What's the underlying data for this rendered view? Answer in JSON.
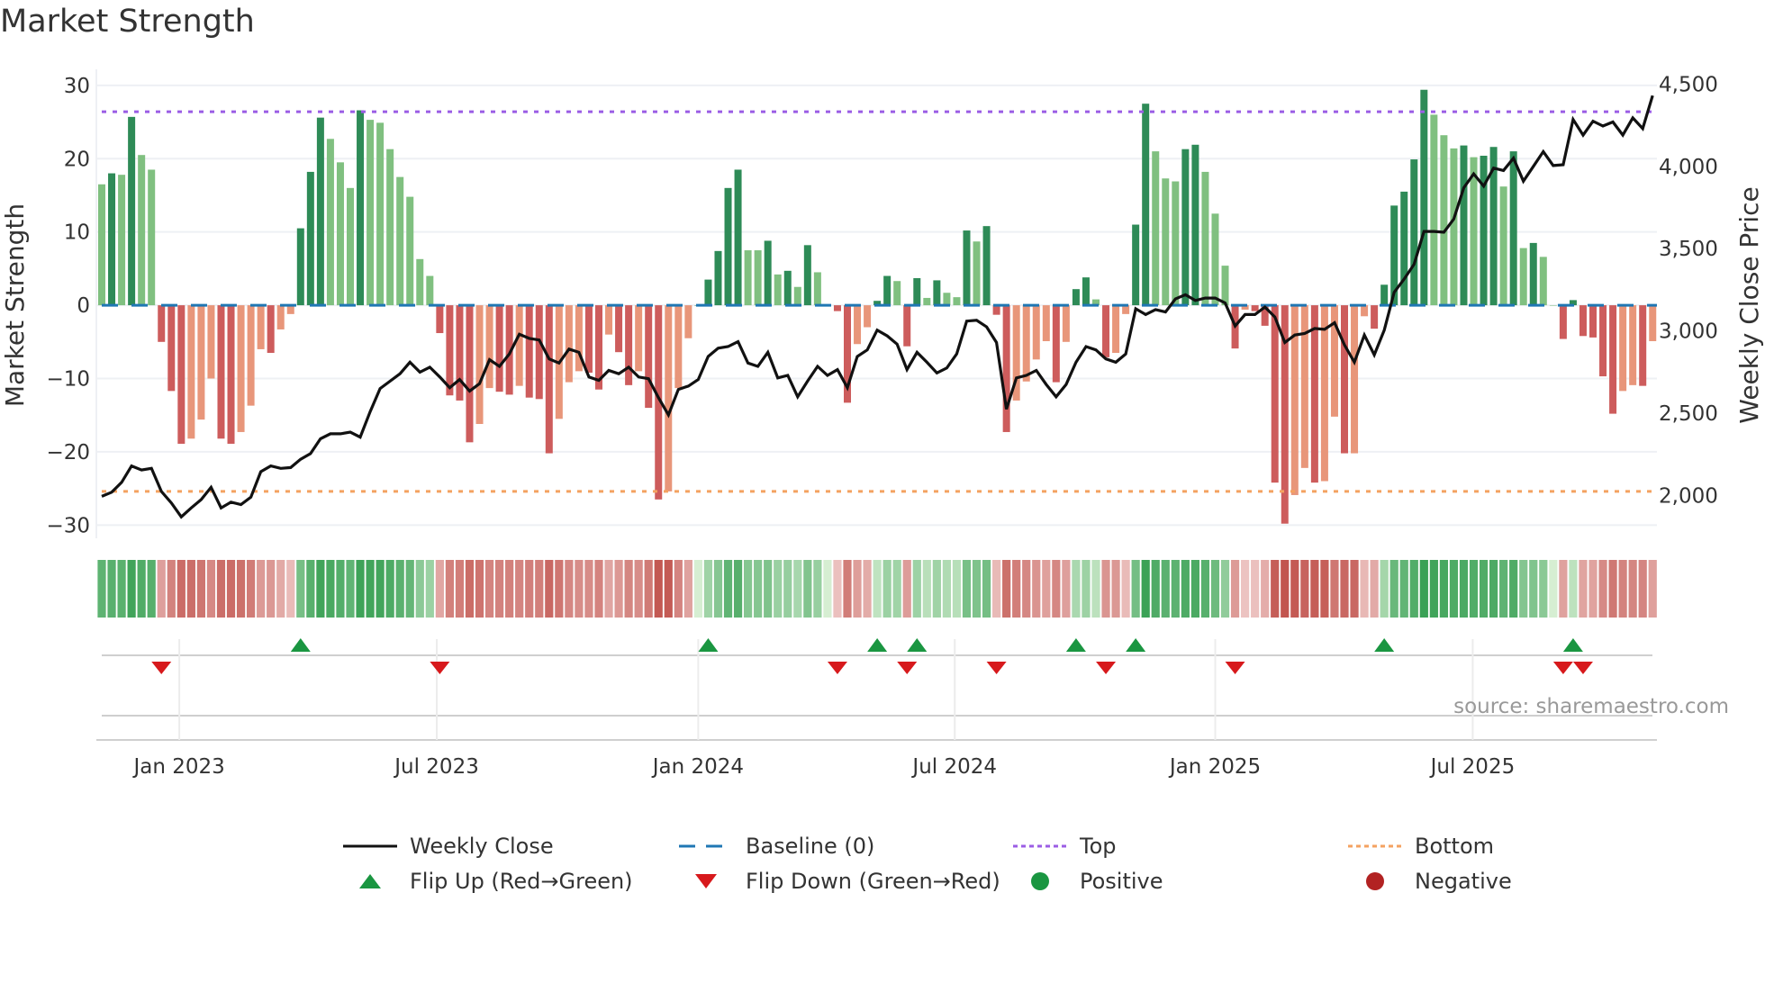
{
  "title": "Market Strength",
  "source": "source: sharemaestro.com",
  "legend": {
    "weekly_close": "Weekly Close",
    "baseline": "Baseline (0)",
    "top": "Top",
    "bottom": "Bottom",
    "flip_up": "Flip Up (Red→Green)",
    "flip_down": "Flip Down (Green→Red)",
    "positive": "Positive",
    "negative": "Negative"
  },
  "colors": {
    "pos_rising": "#2e8b57",
    "pos_falling": "#80c080",
    "neg_falling": "#cd5c5c",
    "neg_rising": "#e8967a",
    "line": "#111111",
    "baseline": "#1f77b4",
    "top": "#9b5de5",
    "bottom": "#f4a261",
    "flip_up": "#1a9641",
    "flip_down": "#d7191c",
    "positive": "#1a9641",
    "negative": "#b22222"
  },
  "chart_data": {
    "type": "bar",
    "title": "Market Strength",
    "ylabel": "Market Strength",
    "y2label": "Weekly Close Price",
    "ylim": [
      -31.8,
      31.7
    ],
    "y2lim": [
      1740,
      4568
    ],
    "yticks": [
      30,
      20,
      10,
      0,
      -10,
      -20,
      -30
    ],
    "ytick_labels": [
      "30",
      "20",
      "10",
      "0",
      "−10",
      "−20",
      "−30"
    ],
    "y2ticks": [
      4500,
      4000,
      3500,
      3000,
      2500,
      2000
    ],
    "y2tick_labels": [
      "4,500",
      "4,000",
      "3,500",
      "3,000",
      "2,500",
      "2,000"
    ],
    "xticks": [
      7.8,
      33.7,
      60,
      85.8,
      112,
      137.9
    ],
    "xtick_labels": [
      "Jan 2023",
      "Jul 2023",
      "Jan 2024",
      "Jul 2024",
      "Jan 2025",
      "Jul 2025"
    ],
    "top_level": 26.4,
    "bottom_level": -25.4,
    "baseline": 0,
    "strength": [
      16.5,
      18,
      17.8,
      25.7,
      20.5,
      18.5,
      -5,
      -11.7,
      -18.9,
      -18.2,
      -15.6,
      -10,
      -18.2,
      -18.9,
      -17.3,
      -13.7,
      -6,
      -6.5,
      -3.3,
      -1.2,
      10.5,
      18.2,
      25.6,
      22.7,
      19.5,
      16,
      26.6,
      25.3,
      24.9,
      21.3,
      17.5,
      14.8,
      6.3,
      4,
      -3.8,
      -12.3,
      -13,
      -18.7,
      -16.2,
      -11.3,
      -11.8,
      -12.2,
      -11,
      -12.6,
      -12.8,
      -20.2,
      -15.5,
      -10.5,
      -9,
      -9.2,
      -11.5,
      -4,
      -6.4,
      -10.9,
      -9,
      -14,
      -26.5,
      -25.4,
      -11.3,
      -4.5,
      0,
      3.5,
      7.4,
      16,
      18.5,
      7.5,
      7.5,
      8.8,
      4.2,
      4.7,
      2.5,
      8.2,
      4.5,
      0,
      -0.8,
      -13.3,
      -5.3,
      -3,
      0.6,
      4,
      3.3,
      -5.6,
      3.7,
      1,
      3.4,
      1.7,
      1.1,
      10.2,
      8.7,
      10.8,
      -1.3,
      -17.3,
      -13,
      -10.4,
      -7.4,
      -4.9,
      -10.5,
      -5,
      2.2,
      3.8,
      0.8,
      -7.1,
      -6.5,
      -1.2,
      11,
      27.5,
      21,
      17.3,
      16.9,
      21.3,
      21.9,
      18.2,
      12.5,
      5.4,
      -5.9,
      -0.6,
      -0.8,
      -2.8,
      -24.2,
      -29.8,
      -25.9,
      -22.2,
      -24.2,
      -24,
      -15.2,
      -20.2,
      -20.2,
      -1.5,
      -3.2,
      2.8,
      13.6,
      15.5,
      19.9,
      29.4,
      26,
      23.2,
      21.4,
      21.8,
      20.2,
      20.4,
      21.6,
      16.2,
      21,
      7.8,
      8.5,
      6.6,
      0,
      -4.6,
      0.7,
      -4.2,
      -4.4,
      -9.7,
      -14.8,
      -11.7,
      -10.9,
      -11,
      -4.9
    ],
    "weekly_close": [
      1995,
      2020,
      2080,
      2180,
      2155,
      2165,
      2025,
      1955,
      1870,
      1925,
      1975,
      2050,
      1925,
      1960,
      1945,
      1990,
      2145,
      2180,
      2165,
      2170,
      2220,
      2255,
      2345,
      2375,
      2375,
      2385,
      2355,
      2510,
      2650,
      2695,
      2740,
      2810,
      2750,
      2780,
      2720,
      2655,
      2705,
      2635,
      2680,
      2825,
      2785,
      2860,
      2980,
      2955,
      2945,
      2830,
      2805,
      2890,
      2870,
      2720,
      2700,
      2760,
      2740,
      2780,
      2720,
      2710,
      2595,
      2490,
      2645,
      2665,
      2705,
      2845,
      2895,
      2905,
      2935,
      2805,
      2785,
      2870,
      2715,
      2730,
      2600,
      2695,
      2785,
      2730,
      2765,
      2655,
      2845,
      2885,
      3005,
      2970,
      2920,
      2765,
      2870,
      2810,
      2745,
      2775,
      2860,
      3060,
      3065,
      3025,
      2930,
      2525,
      2715,
      2730,
      2760,
      2675,
      2600,
      2675,
      2810,
      2905,
      2885,
      2830,
      2810,
      2860,
      3135,
      3100,
      3130,
      3115,
      3195,
      3220,
      3185,
      3200,
      3200,
      3170,
      3030,
      3100,
      3100,
      3145,
      3085,
      2930,
      2975,
      2985,
      3015,
      3010,
      3050,
      2915,
      2810,
      2975,
      2855,
      3005,
      3235,
      3315,
      3405,
      3605,
      3605,
      3600,
      3680,
      3870,
      3955,
      3880,
      3990,
      3975,
      4050,
      3910,
      4000,
      4090,
      4005,
      4010,
      4285,
      4190,
      4275,
      4245,
      4270,
      4190,
      4295,
      4230,
      4430
    ]
  }
}
